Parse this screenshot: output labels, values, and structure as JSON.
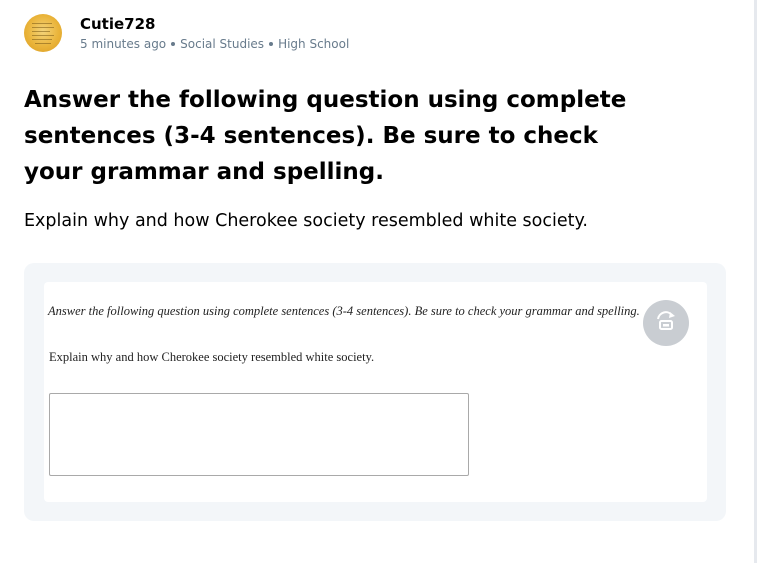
{
  "header": {
    "username": "Cutie728",
    "time": "5 minutes ago",
    "subject": "Social Studies",
    "level": "High School"
  },
  "question": {
    "title": "Answer the following question using complete sentences (3-4 sentences). Be sure to check your grammar and spelling.",
    "body": "Explain why and how Cherokee society resembled white society."
  },
  "attachment": {
    "instruction": "Answer the following question using complete sentences (3-4 sentences). Be sure to check your grammar and spelling.",
    "question": "Explain why and how Cherokee society resembled white society.",
    "textarea_value": "",
    "rotate_icon": "rotate-icon"
  },
  "colors": {
    "meta_text": "#687b8c",
    "attachment_bg": "#f3f6f9",
    "avatar": "#eab43a",
    "rotate_button": "#c9cdd2"
  }
}
